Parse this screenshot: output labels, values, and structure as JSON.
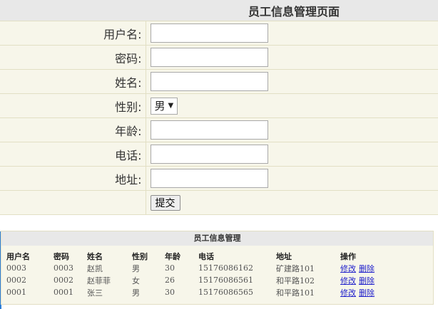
{
  "form": {
    "title": "员工信息管理页面",
    "labels": {
      "username": "用户名:",
      "password": "密码:",
      "name": "姓名:",
      "gender": "性别:",
      "age": "年龄:",
      "phone": "电话:",
      "address": "地址:"
    },
    "values": {
      "username": "",
      "password": "",
      "name": "",
      "age": "",
      "phone": "",
      "address": ""
    },
    "gender_selected": "男",
    "submit_label": "提交"
  },
  "list": {
    "title": "员工信息管理",
    "headers": [
      "用户名",
      "密码",
      "姓名",
      "性别",
      "年龄",
      "电话",
      "地址",
      "操作"
    ],
    "rows": [
      {
        "username": "0003",
        "password": "0003",
        "name": "赵凯",
        "gender": "男",
        "age": "30",
        "phone": "15176086162",
        "address": "矿建路101",
        "edit": "修改",
        "delete": "删除"
      },
      {
        "username": "0002",
        "password": "0002",
        "name": "赵菲菲",
        "gender": "女",
        "age": "26",
        "phone": "15176086561",
        "address": "和平路102",
        "edit": "修改",
        "delete": "删除"
      },
      {
        "username": "0001",
        "password": "0001",
        "name": "张三",
        "gender": "男",
        "age": "30",
        "phone": "15176086565",
        "address": "和平路101",
        "edit": "修改",
        "delete": "删除"
      }
    ]
  },
  "colors": {
    "panel_bg": "#f7f6ea",
    "title_bg": "#e8e8e8",
    "border": "#e2dfc4",
    "link": "#2222cc",
    "accent": "#2f7fd6"
  },
  "icons": {
    "gender_dropdown": "triangle-down"
  }
}
